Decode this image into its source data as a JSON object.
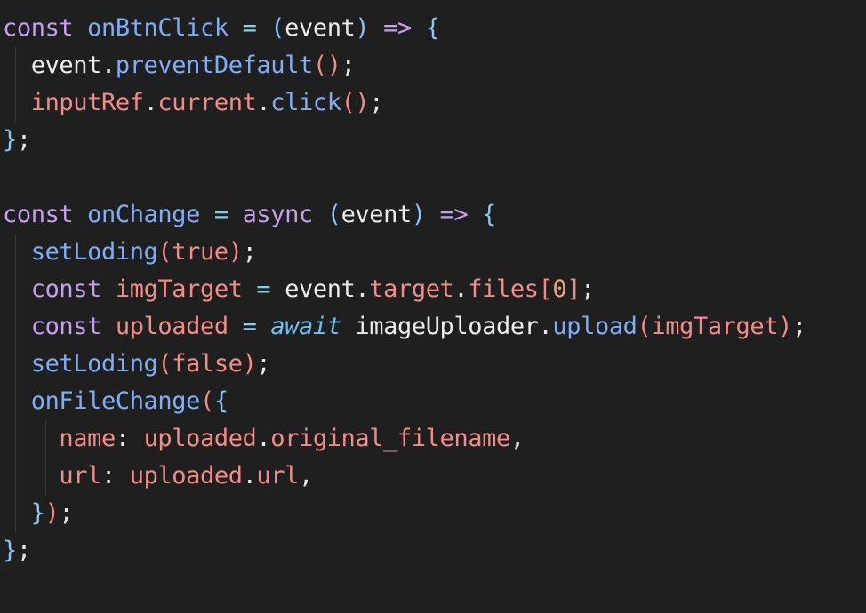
{
  "code_lines": [
    {
      "indent": 0,
      "tokens": [
        {
          "t": "const",
          "c": "kw"
        },
        {
          "t": " ",
          "c": "pl"
        },
        {
          "t": "onBtnClick",
          "c": "fn"
        },
        {
          "t": " ",
          "c": "pl"
        },
        {
          "t": "=",
          "c": "op"
        },
        {
          "t": " ",
          "c": "pl"
        },
        {
          "t": "(",
          "c": "br1"
        },
        {
          "t": "event",
          "c": "pl"
        },
        {
          "t": ")",
          "c": "br1"
        },
        {
          "t": " ",
          "c": "pl"
        },
        {
          "t": "=>",
          "c": "kw"
        },
        {
          "t": " ",
          "c": "pl"
        },
        {
          "t": "{",
          "c": "br1"
        }
      ]
    },
    {
      "indent": 1,
      "tokens": [
        {
          "t": "  ",
          "c": "pl"
        },
        {
          "t": "event",
          "c": "pl"
        },
        {
          "t": ".",
          "c": "pun"
        },
        {
          "t": "preventDefault",
          "c": "fn"
        },
        {
          "t": "()",
          "c": "br3"
        },
        {
          "t": ";",
          "c": "pun"
        }
      ]
    },
    {
      "indent": 1,
      "tokens": [
        {
          "t": "  ",
          "c": "pl"
        },
        {
          "t": "inputRef",
          "c": "prop"
        },
        {
          "t": ".",
          "c": "pun"
        },
        {
          "t": "current",
          "c": "prop"
        },
        {
          "t": ".",
          "c": "pun"
        },
        {
          "t": "click",
          "c": "fn"
        },
        {
          "t": "()",
          "c": "br3"
        },
        {
          "t": ";",
          "c": "pun"
        }
      ]
    },
    {
      "indent": 0,
      "tokens": [
        {
          "t": "}",
          "c": "br1"
        },
        {
          "t": ";",
          "c": "pun"
        }
      ]
    },
    {
      "indent": 0,
      "tokens": []
    },
    {
      "indent": 0,
      "tokens": [
        {
          "t": "const",
          "c": "kw"
        },
        {
          "t": " ",
          "c": "pl"
        },
        {
          "t": "onChange",
          "c": "fn"
        },
        {
          "t": " ",
          "c": "pl"
        },
        {
          "t": "=",
          "c": "op"
        },
        {
          "t": " ",
          "c": "pl"
        },
        {
          "t": "async",
          "c": "kw"
        },
        {
          "t": " ",
          "c": "pl"
        },
        {
          "t": "(",
          "c": "br1"
        },
        {
          "t": "event",
          "c": "pl"
        },
        {
          "t": ")",
          "c": "br1"
        },
        {
          "t": " ",
          "c": "pl"
        },
        {
          "t": "=>",
          "c": "kw"
        },
        {
          "t": " ",
          "c": "pl"
        },
        {
          "t": "{",
          "c": "br1"
        }
      ]
    },
    {
      "indent": 1,
      "tokens": [
        {
          "t": "  ",
          "c": "pl"
        },
        {
          "t": "setLoding",
          "c": "fn"
        },
        {
          "t": "(",
          "c": "br3"
        },
        {
          "t": "true",
          "c": "prop"
        },
        {
          "t": ")",
          "c": "br3"
        },
        {
          "t": ";",
          "c": "pun"
        }
      ]
    },
    {
      "indent": 1,
      "tokens": [
        {
          "t": "  ",
          "c": "pl"
        },
        {
          "t": "const",
          "c": "kw"
        },
        {
          "t": " ",
          "c": "pl"
        },
        {
          "t": "imgTarget",
          "c": "prop"
        },
        {
          "t": " ",
          "c": "pl"
        },
        {
          "t": "=",
          "c": "op"
        },
        {
          "t": " ",
          "c": "pl"
        },
        {
          "t": "event",
          "c": "pl"
        },
        {
          "t": ".",
          "c": "pun"
        },
        {
          "t": "target",
          "c": "prop"
        },
        {
          "t": ".",
          "c": "pun"
        },
        {
          "t": "files",
          "c": "prop"
        },
        {
          "t": "[",
          "c": "br3"
        },
        {
          "t": "0",
          "c": "num"
        },
        {
          "t": "]",
          "c": "br3"
        },
        {
          "t": ";",
          "c": "pun"
        }
      ]
    },
    {
      "indent": 1,
      "tokens": [
        {
          "t": "  ",
          "c": "pl"
        },
        {
          "t": "const",
          "c": "kw"
        },
        {
          "t": " ",
          "c": "pl"
        },
        {
          "t": "uploaded",
          "c": "prop"
        },
        {
          "t": " ",
          "c": "pl"
        },
        {
          "t": "=",
          "c": "op"
        },
        {
          "t": " ",
          "c": "pl"
        },
        {
          "t": "await",
          "c": "aw"
        },
        {
          "t": " ",
          "c": "pl"
        },
        {
          "t": "imageUploader",
          "c": "pl"
        },
        {
          "t": ".",
          "c": "pun"
        },
        {
          "t": "upload",
          "c": "fn"
        },
        {
          "t": "(",
          "c": "br3"
        },
        {
          "t": "imgTarget",
          "c": "prop"
        },
        {
          "t": ")",
          "c": "br3"
        },
        {
          "t": ";",
          "c": "pun"
        }
      ]
    },
    {
      "indent": 1,
      "tokens": [
        {
          "t": "  ",
          "c": "pl"
        },
        {
          "t": "setLoding",
          "c": "fn"
        },
        {
          "t": "(",
          "c": "br3"
        },
        {
          "t": "false",
          "c": "prop"
        },
        {
          "t": ")",
          "c": "br3"
        },
        {
          "t": ";",
          "c": "pun"
        }
      ]
    },
    {
      "indent": 1,
      "tokens": [
        {
          "t": "  ",
          "c": "pl"
        },
        {
          "t": "onFileChange",
          "c": "fn"
        },
        {
          "t": "(",
          "c": "br3"
        },
        {
          "t": "{",
          "c": "br1"
        }
      ]
    },
    {
      "indent": 2,
      "tokens": [
        {
          "t": "    ",
          "c": "pl"
        },
        {
          "t": "name",
          "c": "prop"
        },
        {
          "t": ": ",
          "c": "pun"
        },
        {
          "t": "uploaded",
          "c": "prop"
        },
        {
          "t": ".",
          "c": "pun"
        },
        {
          "t": "original_filename",
          "c": "prop"
        },
        {
          "t": ",",
          "c": "pun"
        }
      ]
    },
    {
      "indent": 2,
      "tokens": [
        {
          "t": "    ",
          "c": "pl"
        },
        {
          "t": "url",
          "c": "prop"
        },
        {
          "t": ": ",
          "c": "pun"
        },
        {
          "t": "uploaded",
          "c": "prop"
        },
        {
          "t": ".",
          "c": "pun"
        },
        {
          "t": "url",
          "c": "prop"
        },
        {
          "t": ",",
          "c": "pun"
        }
      ]
    },
    {
      "indent": 1,
      "tokens": [
        {
          "t": "  ",
          "c": "pl"
        },
        {
          "t": "}",
          "c": "br1"
        },
        {
          "t": ")",
          "c": "br3"
        },
        {
          "t": ";",
          "c": "pun"
        }
      ]
    },
    {
      "indent": 0,
      "tokens": [
        {
          "t": "}",
          "c": "br1"
        },
        {
          "t": ";",
          "c": "pun"
        }
      ]
    }
  ],
  "colors": {
    "background": "#1f1f1f",
    "keyword": "#c59ff0",
    "function": "#80adf5",
    "operator": "#84cfe8",
    "property": "#f28c89",
    "number": "#f1a07a",
    "await": "#6fc0f0",
    "plain": "#ececec"
  }
}
